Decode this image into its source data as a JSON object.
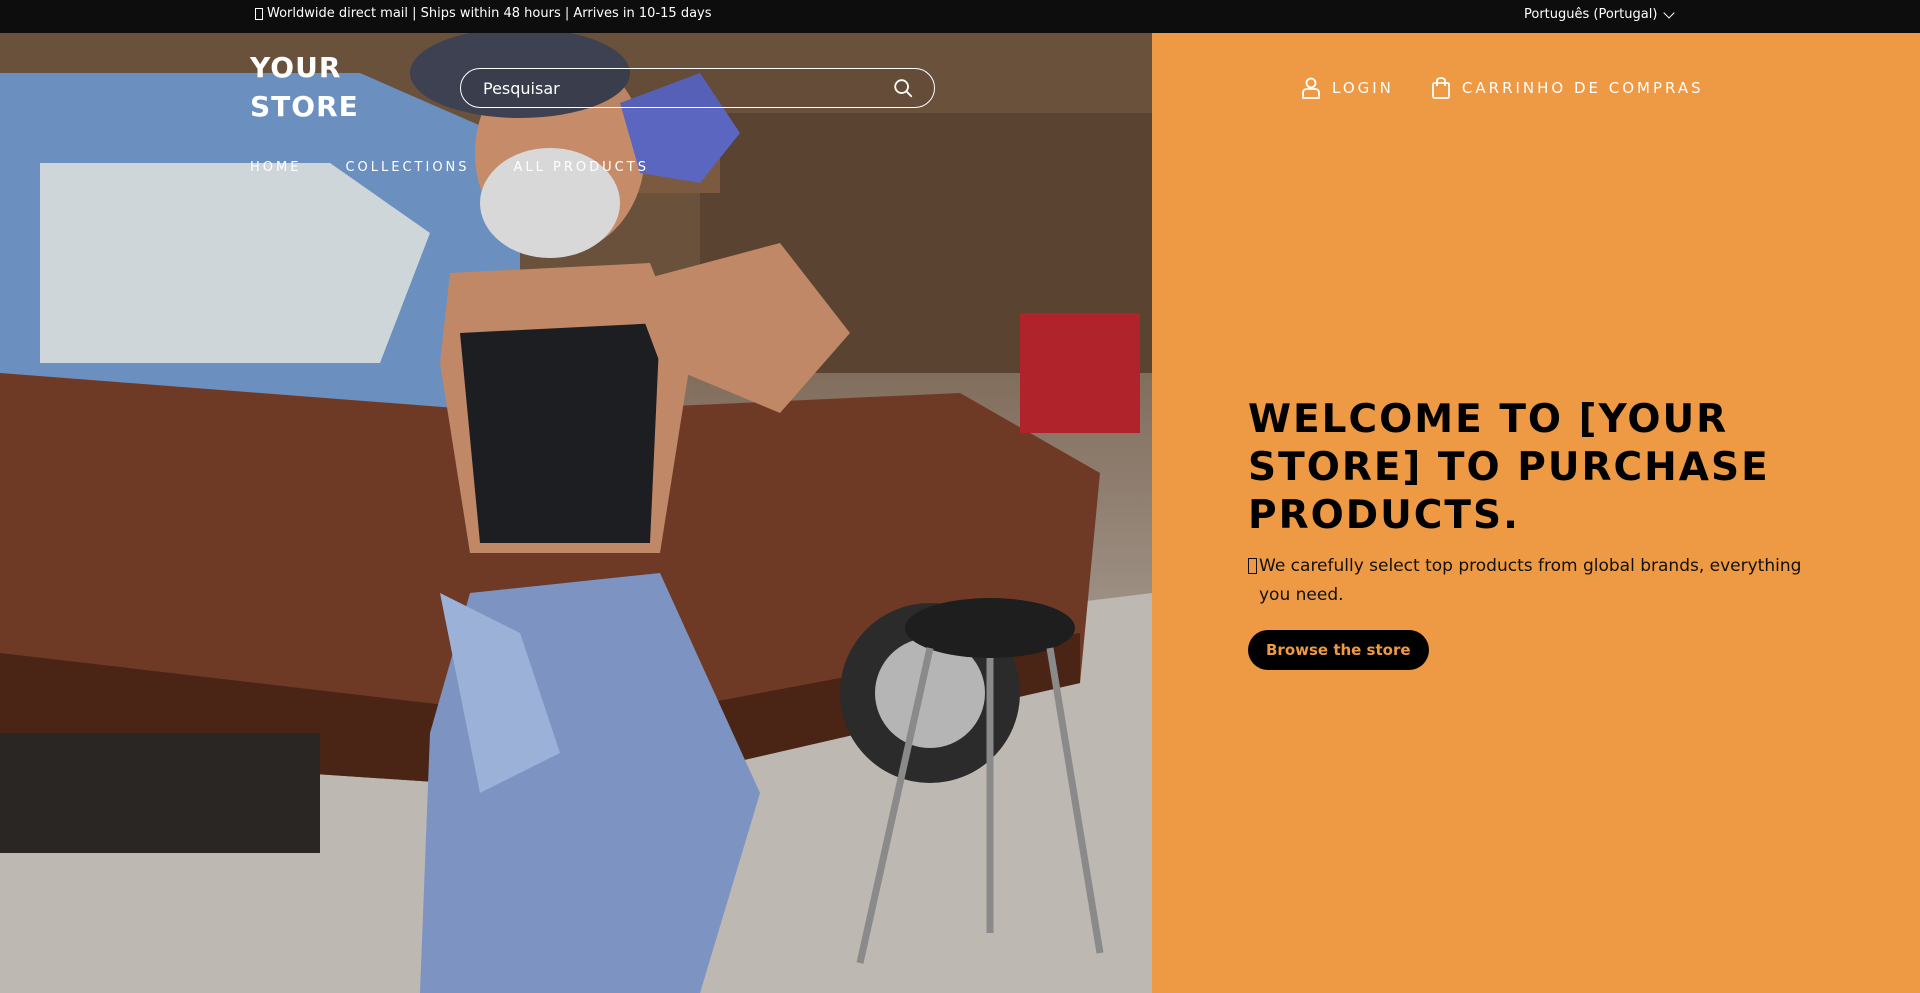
{
  "announcement": {
    "text": "Worldwide direct mail | Ships within 48 hours | Arrives in 10-15 days",
    "glyph_icon": "missing-glyph-icon"
  },
  "language": {
    "selected": "Português (Portugal)",
    "icon": "chevron-down-icon"
  },
  "header": {
    "logo_line1": "YOUR",
    "logo_line2": "STORE",
    "search_placeholder": "Pesquisar",
    "search_icon": "search-icon",
    "nav": [
      {
        "label": "HOME"
      },
      {
        "label": "COLLECTIONS"
      },
      {
        "label": "ALL PRODUCTS"
      }
    ],
    "login_label": "LOGIN",
    "login_icon": "user-icon",
    "cart_label": "CARRINHO DE COMPRAS",
    "cart_icon": "shopping-bag-icon"
  },
  "hero": {
    "title": "WELCOME TO [YOUR STORE] TO PURCHASE PRODUCTS.",
    "subtitle": "We carefully select top products from global brands, everything you need.",
    "button_label": "Browse the store",
    "image_alt": "woman-mechanic-garage-photo"
  },
  "colors": {
    "accent": "#ee9944",
    "topbar": "#0d0d0d",
    "text_dark": "#000000",
    "text_light": "#ffffff"
  }
}
